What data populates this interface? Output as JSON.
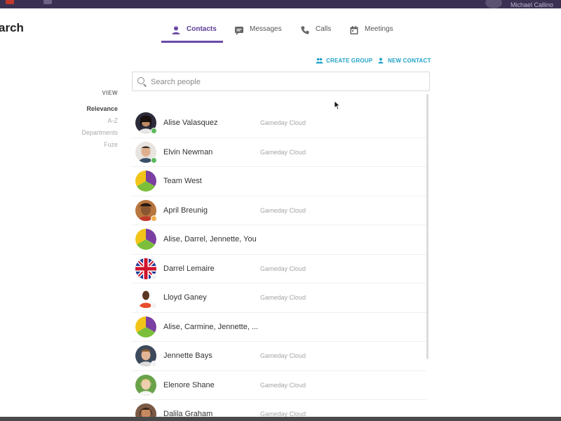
{
  "window": {
    "user_name": "Michael Callino"
  },
  "page": {
    "title": "arch"
  },
  "tabs": [
    {
      "label": "Contacts",
      "icon": "person-icon",
      "active": true
    },
    {
      "label": "Messages",
      "icon": "chat-bubble-icon",
      "active": false
    },
    {
      "label": "Calls",
      "icon": "phone-icon",
      "active": false
    },
    {
      "label": "Meetings",
      "icon": "calendar-icon",
      "active": false
    }
  ],
  "actions": {
    "create_group": "CREATE GROUP",
    "new_contact": "NEW CONTACT"
  },
  "search": {
    "placeholder": "Search people",
    "value": ""
  },
  "view": {
    "label": "VIEW",
    "options": [
      "Relevance",
      "A-Z",
      "Departments",
      "Fuze"
    ],
    "selected": "Relevance"
  },
  "contacts": [
    {
      "name": "Alise Valasquez",
      "org": "Gameday Cloud",
      "avatar": "photo",
      "status": "online"
    },
    {
      "name": "Elvin Newman",
      "org": "Gameday Cloud",
      "avatar": "photo",
      "status": "online"
    },
    {
      "name": "Team West",
      "org": "",
      "avatar": "group",
      "status": ""
    },
    {
      "name": "April Breunig",
      "org": "Gameday Cloud",
      "avatar": "photo",
      "status": "away"
    },
    {
      "name": "Alise, Darrel, Jennette, You",
      "org": "",
      "avatar": "group",
      "status": ""
    },
    {
      "name": "Darrel Lemaire",
      "org": "Gameday Cloud",
      "avatar": "union-jack",
      "status": "offline"
    },
    {
      "name": "Lloyd Ganey",
      "org": "Gameday Cloud",
      "avatar": "photo",
      "status": "offline"
    },
    {
      "name": "Alise, Carmine, Jennette, ...",
      "org": "",
      "avatar": "group",
      "status": ""
    },
    {
      "name": "Jennette Bays",
      "org": "Gameday Cloud",
      "avatar": "photo",
      "status": "offline"
    },
    {
      "name": "Elenore Shane",
      "org": "Gameday Cloud",
      "avatar": "photo",
      "status": ""
    },
    {
      "name": "Dalila Graham",
      "org": "Gameday Cloud",
      "avatar": "photo",
      "status": ""
    }
  ],
  "colors": {
    "accent_purple": "#6a4aa8",
    "action_blue": "#1fa3c8",
    "status_online": "#5cb85c",
    "status_away": "#f0ad4e",
    "group_yellow": "#f2c417",
    "group_purple": "#7a3fa0",
    "group_green": "#7cbf3a"
  }
}
